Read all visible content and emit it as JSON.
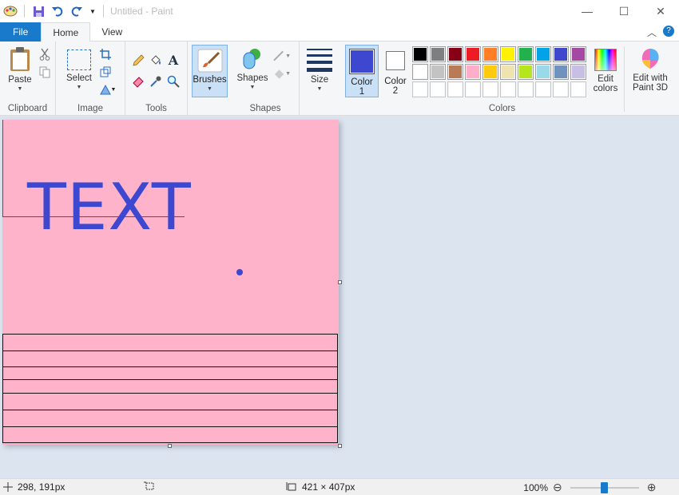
{
  "window": {
    "title": "Untitled - Paint",
    "controls": {
      "minimize": "—",
      "maximize": "☐",
      "close": "✕"
    }
  },
  "tabs": [
    {
      "label": "File"
    },
    {
      "label": "Home"
    },
    {
      "label": "View"
    }
  ],
  "ribbon": {
    "clipboard": {
      "group_label": "Clipboard",
      "paste_label": "Paste"
    },
    "image": {
      "group_label": "Image",
      "select_label": "Select"
    },
    "tools": {
      "group_label": "Tools",
      "brushes_label": "Brushes"
    },
    "shapes": {
      "group_label": "Shapes",
      "shapes_label": "Shapes"
    },
    "size": {
      "label": "Size"
    },
    "color1": {
      "line1": "Color",
      "line2": "1",
      "value": "#3d47d0"
    },
    "color2": {
      "line1": "Color",
      "line2": "2",
      "value": "#ffffff"
    },
    "colors": {
      "group_label": "Colors",
      "row1": [
        "#000000",
        "#7f7f7f",
        "#880015",
        "#ed1c24",
        "#ff7f27",
        "#fff200",
        "#22b14c",
        "#00a2e8",
        "#3f48cc",
        "#a349a4"
      ],
      "row2": [
        "#ffffff",
        "#c3c3c3",
        "#b97a57",
        "#ffaec9",
        "#ffc90e",
        "#efe4b0",
        "#b5e61d",
        "#99d9ea",
        "#7092be",
        "#c8bfe7"
      ],
      "row3": [
        "#ffffff",
        "#ffffff",
        "#ffffff",
        "#ffffff",
        "#ffffff",
        "#ffffff",
        "#ffffff",
        "#ffffff",
        "#ffffff",
        "#ffffff"
      ]
    },
    "edit_colors": {
      "line1": "Edit",
      "line2": "colors"
    },
    "paint3d": {
      "line1": "Edit with",
      "line2": "Paint 3D"
    }
  },
  "canvas": {
    "background": "#ffb3cb",
    "text": "TEXT",
    "text_color": "#3d47d0"
  },
  "status": {
    "cursor_position": "298, 191px",
    "canvas_size": "421 × 407px",
    "zoom": "100%",
    "zoom_out": "⊖",
    "zoom_in": "⊕"
  }
}
